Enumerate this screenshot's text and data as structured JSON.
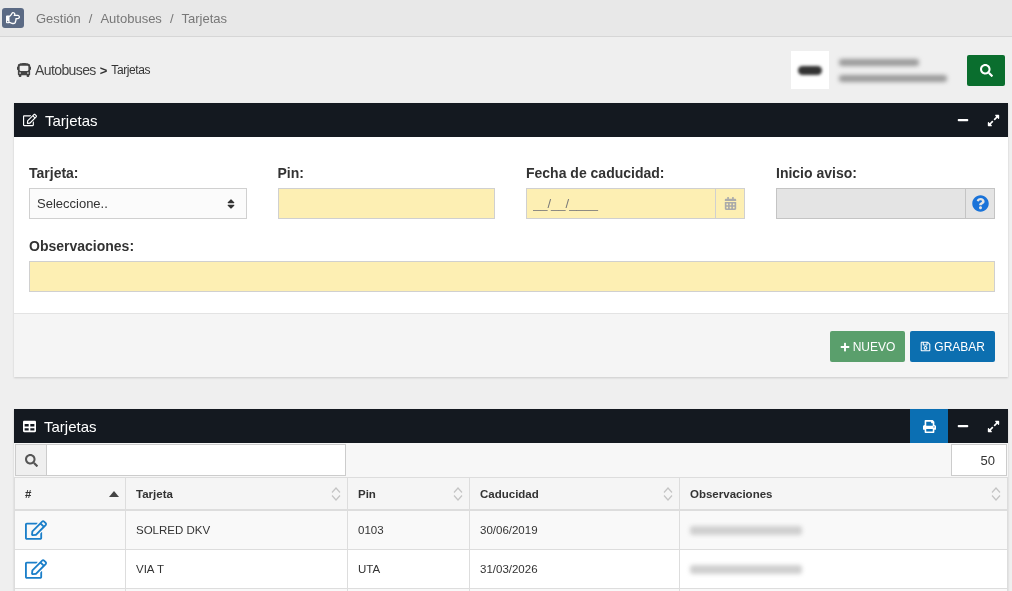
{
  "top_bar": {
    "breadcrumb": [
      {
        "label": "Gestión",
        "separator": "/"
      },
      {
        "label": "Autobuses",
        "separator": "/"
      },
      {
        "label": "Tarjetas"
      }
    ]
  },
  "page_header": {
    "section": "Autobuses",
    "separator": ">",
    "page": "Tarjetas",
    "vehicle_info": {
      "has_photo": true,
      "text_redacted": true
    }
  },
  "form_panel": {
    "title": "Tarjetas",
    "fields": [
      {
        "kind": "select",
        "label": "Tarjeta:",
        "value": "Seleccione..",
        "required": false,
        "disabled": false
      },
      {
        "kind": "text",
        "label": "Pin:",
        "required": true,
        "disabled": false
      },
      {
        "kind": "date",
        "label": "Fecha de caducidad:",
        "placeholder": "__/__/____",
        "required": true,
        "disabled": false
      },
      {
        "kind": "help",
        "label": "Inicio aviso:",
        "required": false,
        "disabled": true
      }
    ],
    "notes": {
      "label": "Observaciones:",
      "required": true
    },
    "buttons": [
      {
        "kind": "new",
        "label": "NUEVO"
      },
      {
        "kind": "save",
        "label": "GRABAR"
      }
    ]
  },
  "table_panel": {
    "title": "Tarjetas",
    "page_size": "50",
    "columns": [
      {
        "label": "#",
        "sorted": true
      },
      {
        "label": "Tarjeta",
        "sorted": false
      },
      {
        "label": "Pin",
        "sorted": false
      },
      {
        "label": "Caducidad",
        "sorted": false
      },
      {
        "label": "Observaciones",
        "sorted": false
      }
    ],
    "rows": [
      {
        "cells": [
          "",
          "SOLRED DKV",
          "0103",
          "30/06/2019"
        ],
        "notes_redacted": true
      },
      {
        "cells": [
          "",
          "VIA T",
          "UTA",
          "31/03/2026"
        ],
        "notes_redacted": true
      }
    ]
  }
}
